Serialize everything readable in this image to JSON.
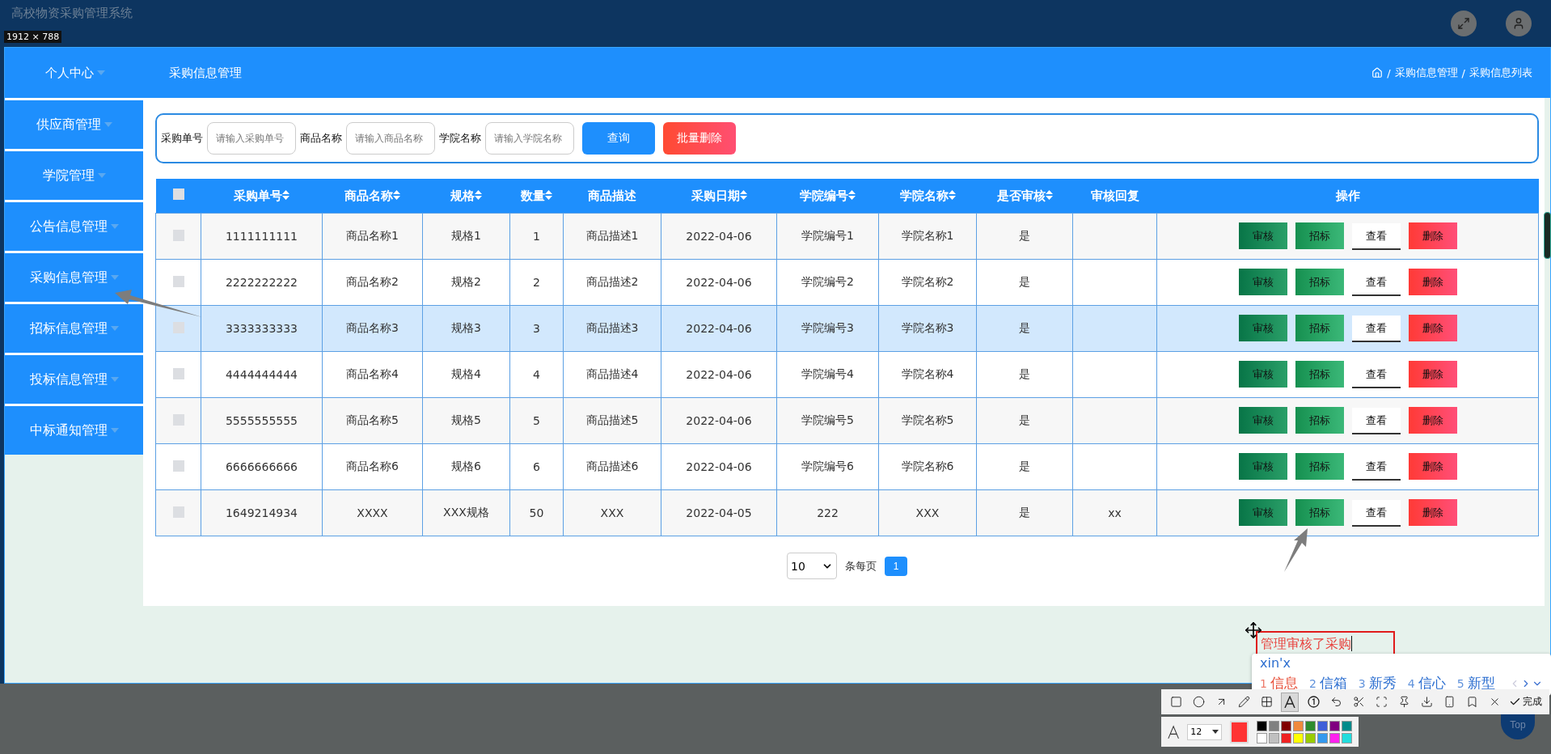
{
  "topbar": {
    "title": "高校物资采购管理系统",
    "size_label": "1912 × 788"
  },
  "header": {
    "user_menu": "个人中心",
    "page_title": "采购信息管理",
    "breadcrumb": [
      {
        "separator": "/",
        "label": "采购信息管理"
      },
      {
        "separator": "/",
        "label": "采购信息列表"
      }
    ]
  },
  "sidebar": {
    "items": [
      {
        "label": "供应商管理"
      },
      {
        "label": "学院管理"
      },
      {
        "label": "公告信息管理"
      },
      {
        "label": "采购信息管理"
      },
      {
        "label": "招标信息管理"
      },
      {
        "label": "投标信息管理"
      },
      {
        "label": "中标通知管理"
      }
    ]
  },
  "search": {
    "fields": [
      {
        "label": "采购单号",
        "placeholder": "请输入采购单号"
      },
      {
        "label": "商品名称",
        "placeholder": "请输入商品名称"
      },
      {
        "label": "学院名称",
        "placeholder": "请输入学院名称"
      }
    ],
    "buttons": [
      {
        "label": "查询",
        "kind": "primary"
      },
      {
        "label": "批量删除",
        "kind": "danger"
      }
    ]
  },
  "table": {
    "select_all_checked": false,
    "columns": [
      {
        "label": "采购单号",
        "sortable": true
      },
      {
        "label": "商品名称",
        "sortable": true
      },
      {
        "label": "规格",
        "sortable": true
      },
      {
        "label": "数量",
        "sortable": true
      },
      {
        "label": "商品描述",
        "sortable": false
      },
      {
        "label": "采购日期",
        "sortable": true
      },
      {
        "label": "学院编号",
        "sortable": true
      },
      {
        "label": "学院名称",
        "sortable": true
      },
      {
        "label": "是否审核",
        "sortable": true
      },
      {
        "label": "审核回复",
        "sortable": false
      },
      {
        "label": "操作",
        "sortable": false
      }
    ],
    "rows": [
      {
        "selected": false,
        "checked": false,
        "cells": [
          "1111111111",
          "商品名称1",
          "规格1",
          "1",
          "商品描述1",
          "2022-04-06",
          "学院编号1",
          "学院名称1",
          "是",
          ""
        ],
        "actions": [
          {
            "label": "审核",
            "kind": "audit"
          },
          {
            "label": "招标",
            "kind": "bid"
          },
          {
            "label": "查看",
            "kind": "view"
          },
          {
            "label": "删除",
            "kind": "delete"
          }
        ]
      },
      {
        "selected": false,
        "checked": false,
        "cells": [
          "2222222222",
          "商品名称2",
          "规格2",
          "2",
          "商品描述2",
          "2022-04-06",
          "学院编号2",
          "学院名称2",
          "是",
          ""
        ],
        "actions": [
          {
            "label": "审核",
            "kind": "audit"
          },
          {
            "label": "招标",
            "kind": "bid"
          },
          {
            "label": "查看",
            "kind": "view"
          },
          {
            "label": "删除",
            "kind": "delete"
          }
        ]
      },
      {
        "selected": true,
        "checked": false,
        "cells": [
          "3333333333",
          "商品名称3",
          "规格3",
          "3",
          "商品描述3",
          "2022-04-06",
          "学院编号3",
          "学院名称3",
          "是",
          ""
        ],
        "actions": [
          {
            "label": "审核",
            "kind": "audit"
          },
          {
            "label": "招标",
            "kind": "bid"
          },
          {
            "label": "查看",
            "kind": "view"
          },
          {
            "label": "删除",
            "kind": "delete"
          }
        ]
      },
      {
        "selected": false,
        "checked": false,
        "cells": [
          "4444444444",
          "商品名称4",
          "规格4",
          "4",
          "商品描述4",
          "2022-04-06",
          "学院编号4",
          "学院名称4",
          "是",
          ""
        ],
        "actions": [
          {
            "label": "审核",
            "kind": "audit"
          },
          {
            "label": "招标",
            "kind": "bid"
          },
          {
            "label": "查看",
            "kind": "view"
          },
          {
            "label": "删除",
            "kind": "delete"
          }
        ]
      },
      {
        "selected": false,
        "checked": false,
        "cells": [
          "5555555555",
          "商品名称5",
          "规格5",
          "5",
          "商品描述5",
          "2022-04-06",
          "学院编号5",
          "学院名称5",
          "是",
          ""
        ],
        "actions": [
          {
            "label": "审核",
            "kind": "audit"
          },
          {
            "label": "招标",
            "kind": "bid"
          },
          {
            "label": "查看",
            "kind": "view"
          },
          {
            "label": "删除",
            "kind": "delete"
          }
        ]
      },
      {
        "selected": false,
        "checked": false,
        "cells": [
          "6666666666",
          "商品名称6",
          "规格6",
          "6",
          "商品描述6",
          "2022-04-06",
          "学院编号6",
          "学院名称6",
          "是",
          ""
        ],
        "actions": [
          {
            "label": "审核",
            "kind": "audit"
          },
          {
            "label": "招标",
            "kind": "bid"
          },
          {
            "label": "查看",
            "kind": "view"
          },
          {
            "label": "删除",
            "kind": "delete"
          }
        ]
      },
      {
        "selected": false,
        "checked": false,
        "cells": [
          "1649214934",
          "XXXX",
          "XXX规格",
          "50",
          "XXX",
          "2022-04-05",
          "222",
          "XXX",
          "是",
          "xx"
        ],
        "actions": [
          {
            "label": "审核",
            "kind": "audit"
          },
          {
            "label": "招标",
            "kind": "bid"
          },
          {
            "label": "查看",
            "kind": "view"
          },
          {
            "label": "删除",
            "kind": "delete"
          }
        ]
      }
    ]
  },
  "pagination": {
    "page_size": "10",
    "unit": "条每页",
    "pages": [
      {
        "label": "1",
        "selected": true
      }
    ]
  },
  "annotation": {
    "text": "管理审核了采购"
  },
  "ime": {
    "input": "xin'x",
    "candidates": [
      {
        "index": "1",
        "text": "信息",
        "selected": true
      },
      {
        "index": "2",
        "text": "信箱",
        "selected": false
      },
      {
        "index": "3",
        "text": "新秀",
        "selected": false
      },
      {
        "index": "4",
        "text": "信心",
        "selected": false
      },
      {
        "index": "5",
        "text": "新型",
        "selected": false
      }
    ]
  },
  "capture_toolbar": {
    "tools": [
      {
        "kind": "rectangle",
        "selected": false
      },
      {
        "kind": "ellipse",
        "selected": false
      },
      {
        "kind": "arrow",
        "selected": false
      },
      {
        "kind": "pencil",
        "selected": false
      },
      {
        "kind": "mosaic",
        "selected": false
      },
      {
        "kind": "text",
        "selected": true
      },
      {
        "kind": "number",
        "selected": false
      },
      {
        "kind": "undo",
        "selected": false
      },
      {
        "kind": "cut",
        "selected": false
      },
      {
        "kind": "scan",
        "selected": false
      },
      {
        "kind": "pin",
        "selected": false
      },
      {
        "kind": "download",
        "selected": false
      },
      {
        "kind": "save",
        "selected": false
      },
      {
        "kind": "bookmark",
        "selected": false
      },
      {
        "kind": "close",
        "selected": false
      }
    ],
    "done_label": "完成",
    "font_size": "12",
    "current": {
      "color": "#ff3333"
    },
    "palette": [
      {
        "color": "#000000"
      },
      {
        "color": "#808080"
      },
      {
        "color": "#800000"
      },
      {
        "color": "#f08a3c"
      },
      {
        "color": "#2e8b2e"
      },
      {
        "color": "#3f5fd8"
      },
      {
        "color": "#800080"
      },
      {
        "color": "#008b8b"
      },
      {
        "color": "#ffffff"
      },
      {
        "color": "#c0c0c0"
      },
      {
        "color": "#ee2222"
      },
      {
        "color": "#ffff00"
      },
      {
        "color": "#99cc00"
      },
      {
        "color": "#3399ee"
      },
      {
        "color": "#ff22ee"
      },
      {
        "color": "#22dddd"
      }
    ]
  },
  "back_to_top": "Top"
}
